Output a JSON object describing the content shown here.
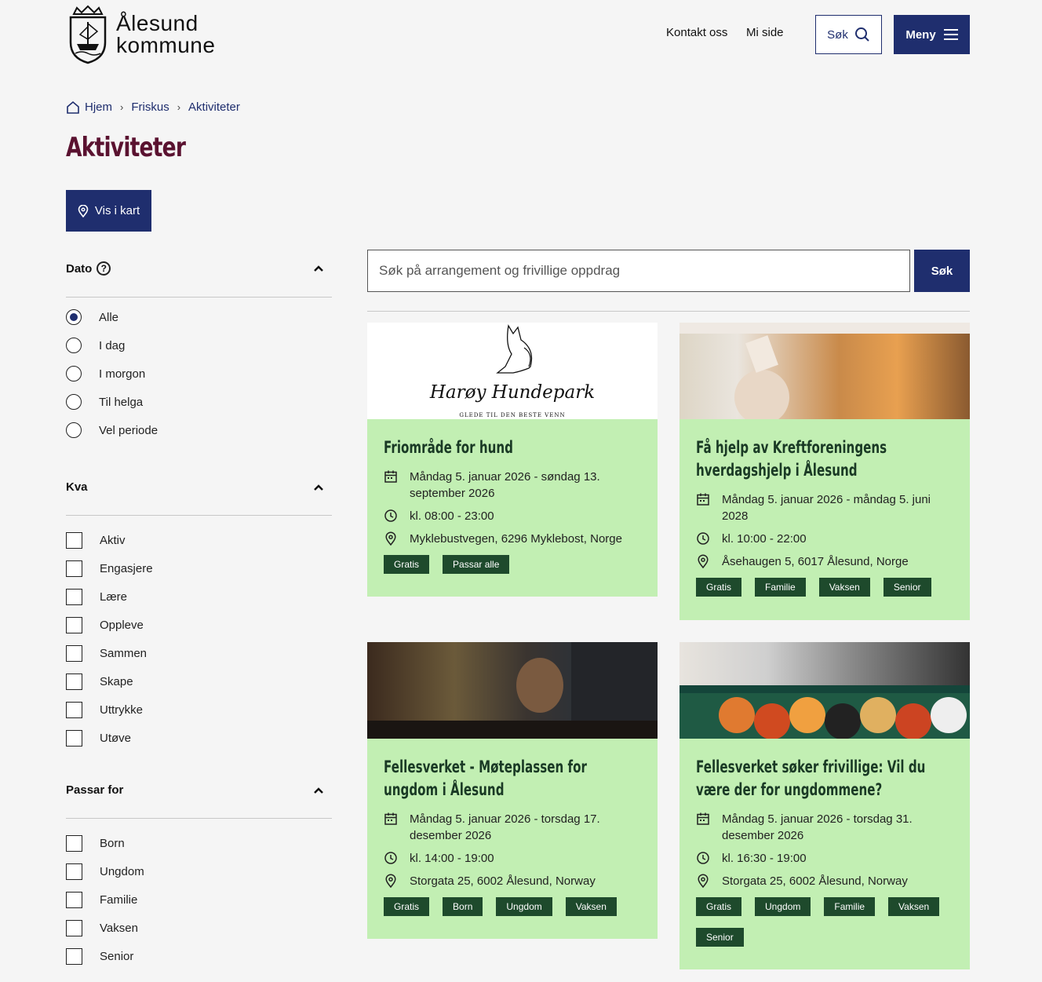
{
  "header": {
    "logo_line1": "Ålesund",
    "logo_line2": "kommune",
    "contact": "Kontakt oss",
    "my_page": "Mi side",
    "search": "Søk",
    "menu": "Meny"
  },
  "breadcrumb": [
    "Hjem",
    "Friskus",
    "Aktiviteter"
  ],
  "title": "Aktiviteter",
  "map_button": "Vis i kart",
  "filters": {
    "date": {
      "label": "Dato",
      "help": "?",
      "options": [
        "Alle",
        "I dag",
        "I morgon",
        "Til helga",
        "Vel periode"
      ],
      "selected": "Alle"
    },
    "what": {
      "label": "Kva",
      "options": [
        "Aktiv",
        "Engasjere",
        "Lære",
        "Oppleve",
        "Sammen",
        "Skape",
        "Uttrykke",
        "Utøve"
      ]
    },
    "for": {
      "label": "Passar for",
      "options": [
        "Born",
        "Ungdom",
        "Familie",
        "Vaksen",
        "Senior"
      ]
    }
  },
  "search": {
    "placeholder": "Søk på arrangement og frivillige oppdrag",
    "button": "Søk"
  },
  "cards": [
    {
      "image_text": "Harøy Hundepark",
      "image_subtext": "GLEDE TIL DEN BESTE VENN",
      "title": "Friområde for hund",
      "date": "Måndag 5. januar 2026 - søndag 13. september 2026",
      "time": "kl. 08:00 - 23:00",
      "place": "Myklebustvegen, 6296 Myklebost, Norge",
      "tags": [
        "Gratis",
        "Passar alle"
      ]
    },
    {
      "title": "Få hjelp av Kreftforeningens hverdagshjelp i Ålesund",
      "date": "Måndag 5. januar 2026 - måndag 5. juni 2028",
      "time": "kl. 10:00 - 22:00",
      "place": "Åsehaugen 5, 6017 Ålesund, Norge",
      "tags": [
        "Gratis",
        "Familie",
        "Vaksen",
        "Senior"
      ]
    },
    {
      "title": "Fellesverket - Møteplassen for ungdom i Ålesund",
      "date": "Måndag 5. januar 2026 - torsdag 17. desember 2026",
      "time": "kl. 14:00 - 19:00",
      "place": "Storgata 25, 6002 Ålesund, Norway",
      "tags": [
        "Gratis",
        "Born",
        "Ungdom",
        "Vaksen"
      ]
    },
    {
      "title": "Fellesverket søker frivillige: Vil du være der for ungdommene?",
      "date": "Måndag 5. januar 2026 - torsdag 31. desember 2026",
      "time": "kl. 16:30 - 19:00",
      "place": "Storgata 25, 6002 Ålesund, Norway",
      "tags": [
        "Gratis",
        "Ungdom",
        "Familie",
        "Vaksen",
        "Senior"
      ]
    }
  ]
}
